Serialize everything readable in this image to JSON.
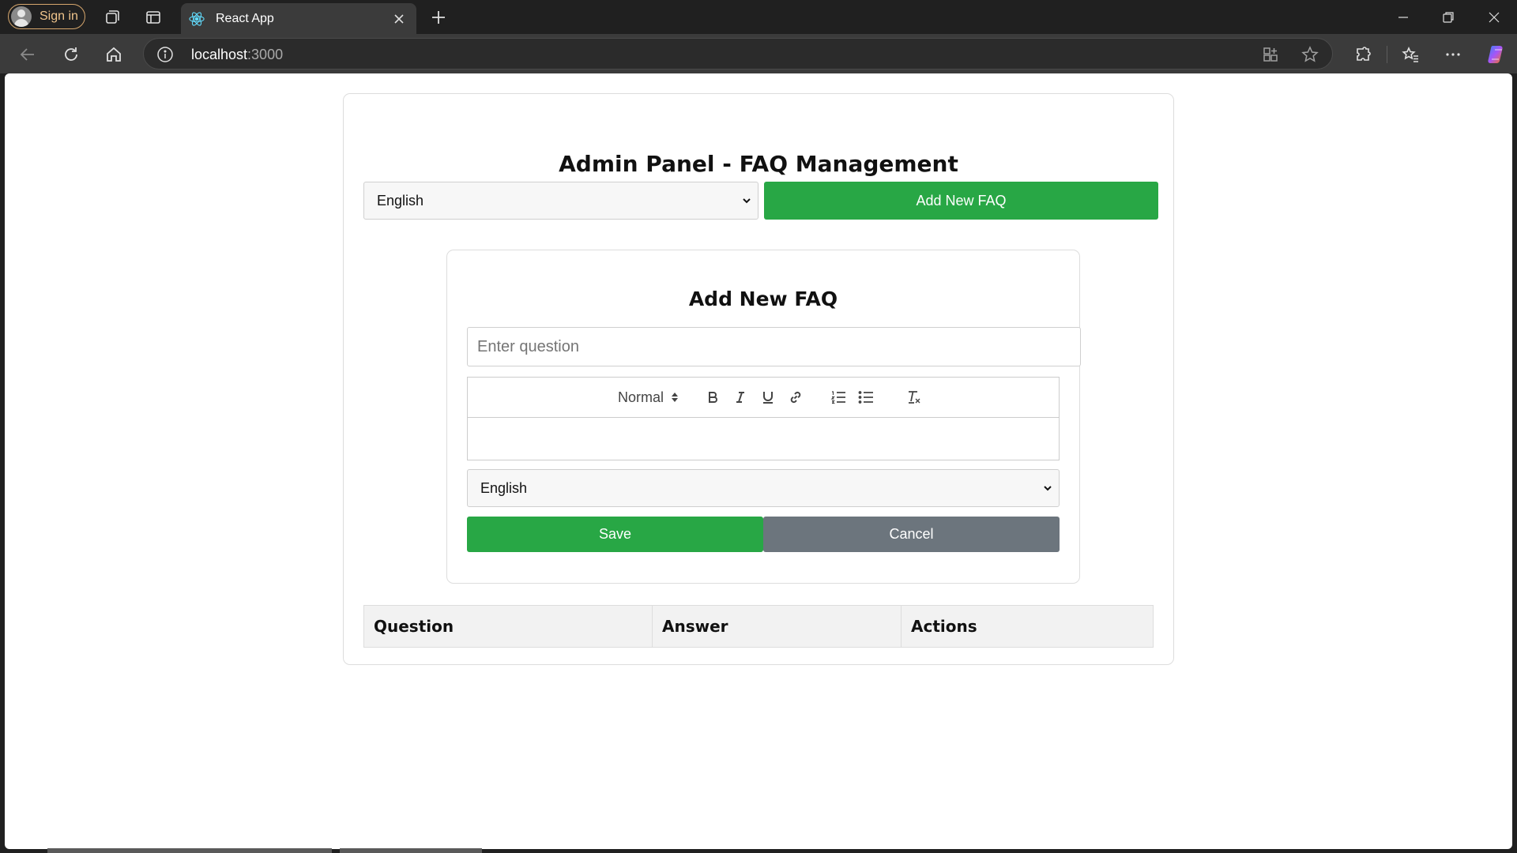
{
  "browser": {
    "signin_label": "Sign in",
    "tab_title": "React App",
    "url_host": "localhost",
    "url_port": ":3000"
  },
  "page": {
    "title": "Admin Panel - FAQ Management",
    "language_filter": {
      "selected": "English"
    },
    "add_button_label": "Add New FAQ"
  },
  "form": {
    "title": "Add New FAQ",
    "question_placeholder": "Enter question",
    "editor": {
      "format_value": "Normal",
      "tools": [
        "bold-icon",
        "italic-icon",
        "underline-icon",
        "link-icon",
        "ordered-list-icon",
        "bullet-list-icon",
        "clear-format-icon"
      ]
    },
    "language": {
      "selected": "English"
    },
    "save_label": "Save",
    "cancel_label": "Cancel"
  },
  "table": {
    "headers": [
      "Question",
      "Answer",
      "Actions"
    ]
  },
  "colors": {
    "primary_green": "#28a745",
    "secondary_grey": "#6c757d"
  }
}
